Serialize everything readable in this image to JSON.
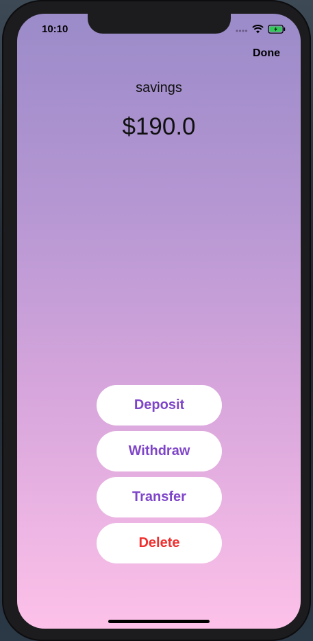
{
  "status_bar": {
    "time": "10:10"
  },
  "nav": {
    "done_label": "Done"
  },
  "account": {
    "name": "savings",
    "balance": "$190.0"
  },
  "actions": [
    {
      "label": "Deposit",
      "color": "#7f45c9"
    },
    {
      "label": "Withdraw",
      "color": "#7f45c9"
    },
    {
      "label": "Transfer",
      "color": "#7f45c9"
    },
    {
      "label": "Delete",
      "color": "#f02f2f"
    }
  ],
  "icons": [
    "signal-icon",
    "wifi-icon",
    "battery-icon"
  ],
  "colors": {
    "gradient_top": "#9b8bc9",
    "gradient_bottom": "#fdc1e9",
    "button_background": "#ffffff"
  }
}
